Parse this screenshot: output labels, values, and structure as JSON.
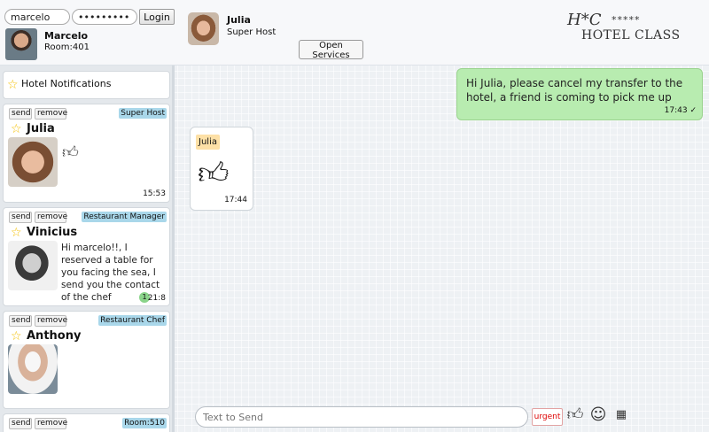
{
  "login": {
    "username": "marcelo",
    "password": "••••••••••••",
    "button": "Login"
  },
  "me": {
    "name": "Marcelo",
    "room": "Room:401"
  },
  "host": {
    "name": "Julia",
    "role": "Super Host"
  },
  "open_services": "Open Services",
  "logo": {
    "mark": "H*C",
    "stars": "*****",
    "text": "HOTEL CLASS"
  },
  "sidebar": {
    "notifications_label": "Hotel Notifications",
    "contacts": [
      {
        "send": "send",
        "remove": "remove",
        "role": "Super Host",
        "name": "Julia",
        "time": "15:53",
        "last_message_icon": "thumbs-up-icon"
      },
      {
        "send": "send",
        "remove": "remove",
        "role": "Restaurant Manager",
        "name": "Vinicius",
        "message": "Hi marcelo!!, I reserved a table for you facing the sea, I send you the contact of the chef",
        "unread": "1",
        "time": "21:8"
      },
      {
        "send": "send",
        "remove": "remove",
        "role": "Restaurant Chef",
        "name": "Anthony"
      },
      {
        "send": "send",
        "remove": "remove",
        "role": "Room:510"
      }
    ]
  },
  "chat": {
    "messages": [
      {
        "direction": "out",
        "text": "Hi Julia, please cancel my transfer to the hotel, a friend is coming to pick me up",
        "time": "17:43 ✓"
      },
      {
        "direction": "in",
        "sender": "Julia",
        "content_icon": "thumbs-up-icon",
        "time": "17:44"
      }
    ]
  },
  "composer": {
    "placeholder": "Text to Send",
    "urgent": "urgent",
    "tools": [
      "thumbs-up-icon",
      "smiley-icon",
      "building-icon"
    ]
  },
  "colors": {
    "outgoing_bubble": "#b8ecb0",
    "role_badge": "#a9d7ea",
    "sender_tag": "#fde0a6",
    "star": "#f5c000",
    "urgent": "#dd0000"
  }
}
